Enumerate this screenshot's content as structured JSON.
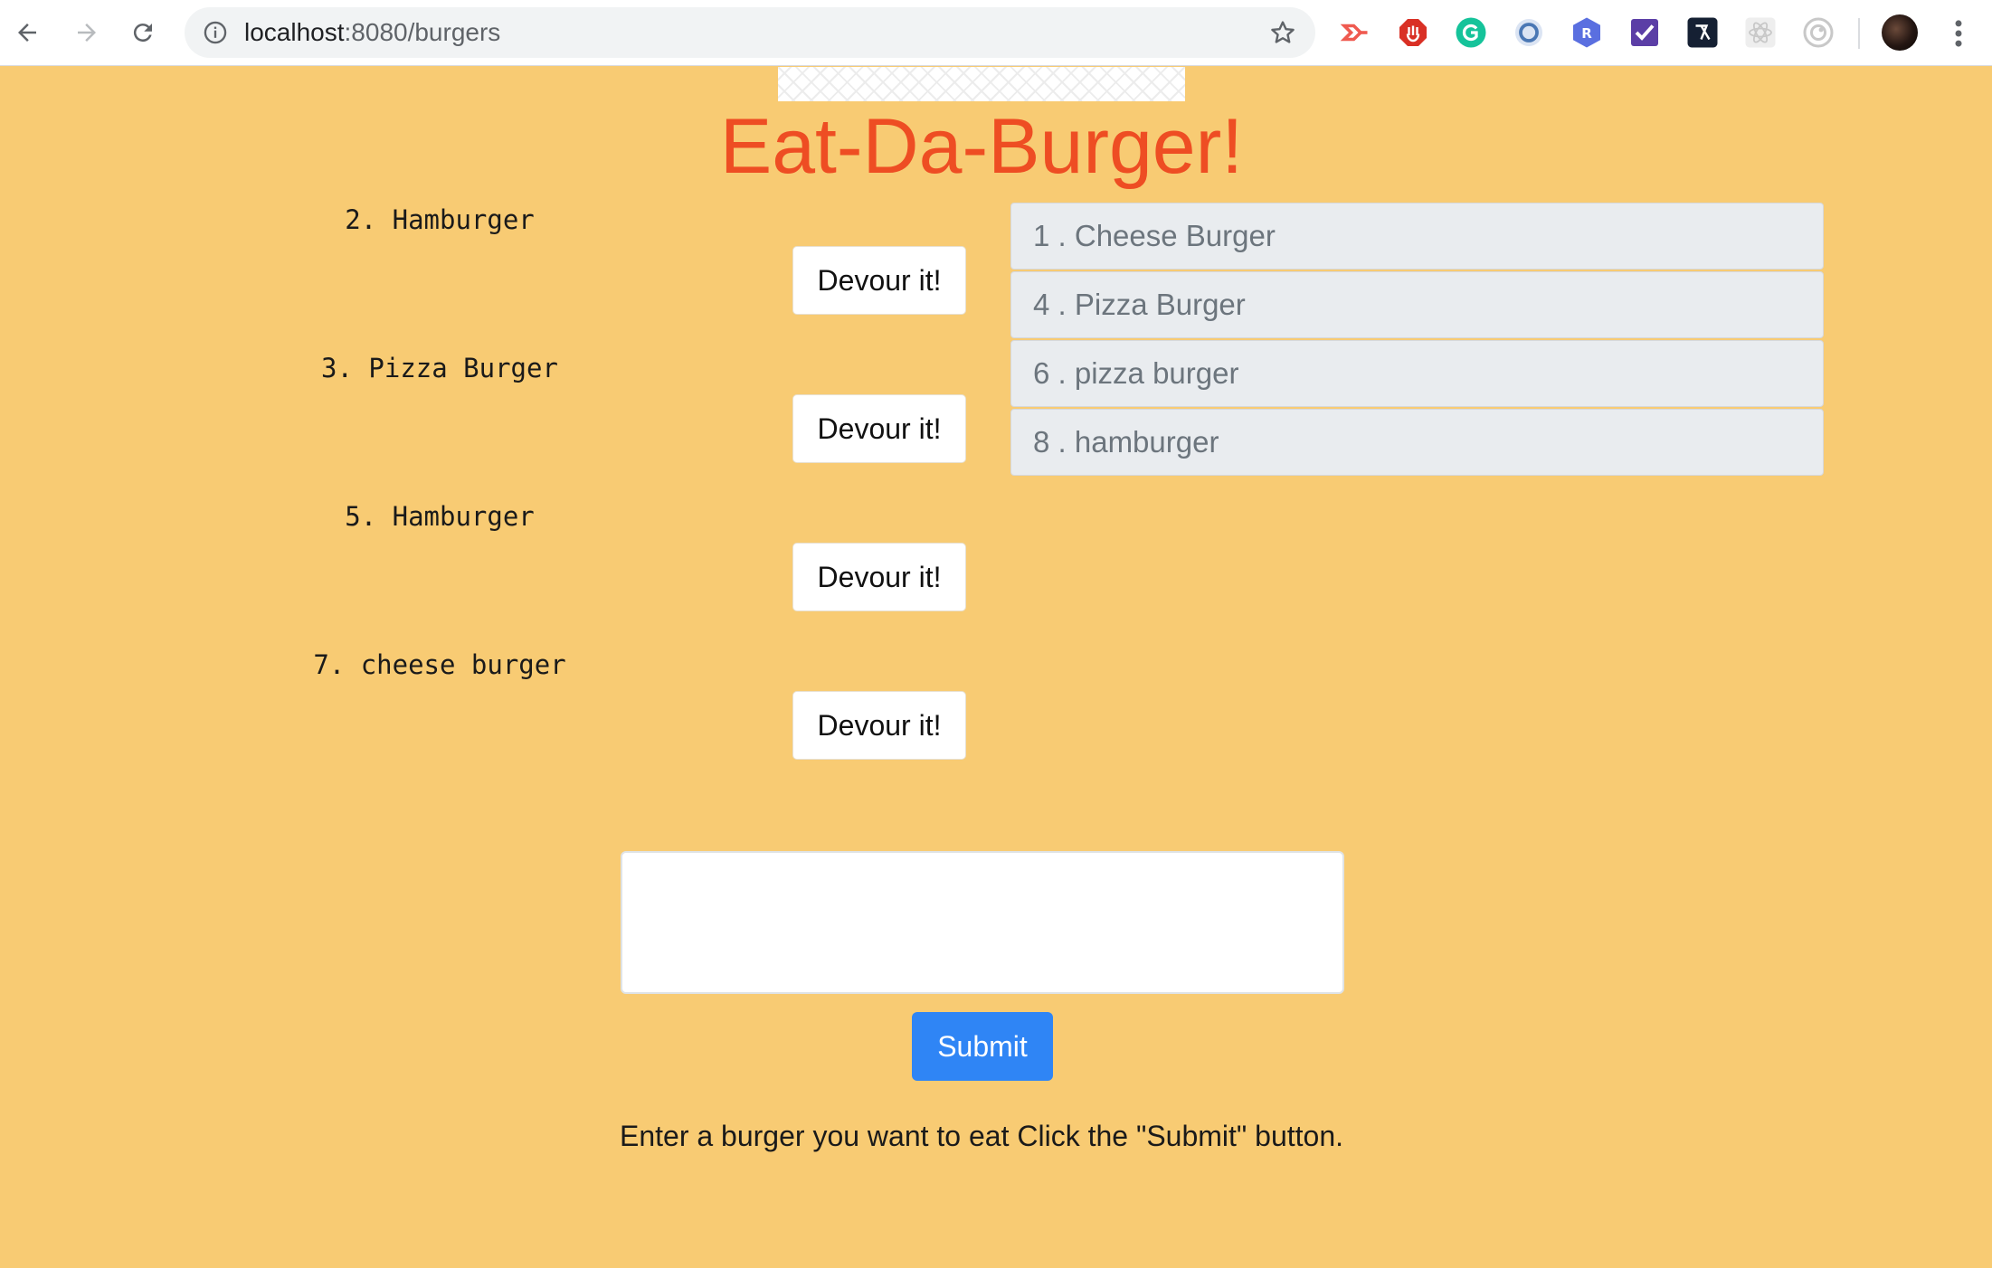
{
  "browser": {
    "url_host": "localhost",
    "url_rest": ":8080/burgers"
  },
  "page": {
    "title": "Eat-Da-Burger!",
    "devour_label": "Devour it!",
    "uneaten": [
      "2. Hamburger",
      "3. Pizza Burger",
      "5. Hamburger",
      "7. cheese burger"
    ],
    "devoured": [
      "1 . Cheese Burger",
      "4 . Pizza Burger",
      "6 . pizza burger",
      "8 . hamburger"
    ],
    "input_value": "",
    "submit_label": "Submit",
    "instructions": "Enter a burger you want to eat Click the \"Submit\" button."
  },
  "colors": {
    "background": "#f8cb73",
    "title": "#ee4d23",
    "submit": "#2f85f5"
  },
  "icons": {
    "extensions": [
      "cast-icon",
      "adblock-icon",
      "grammarly-icon",
      "extension-icon",
      "r-icon",
      "todo-icon",
      "devtools-icon",
      "react-icon",
      "target-icon"
    ]
  }
}
